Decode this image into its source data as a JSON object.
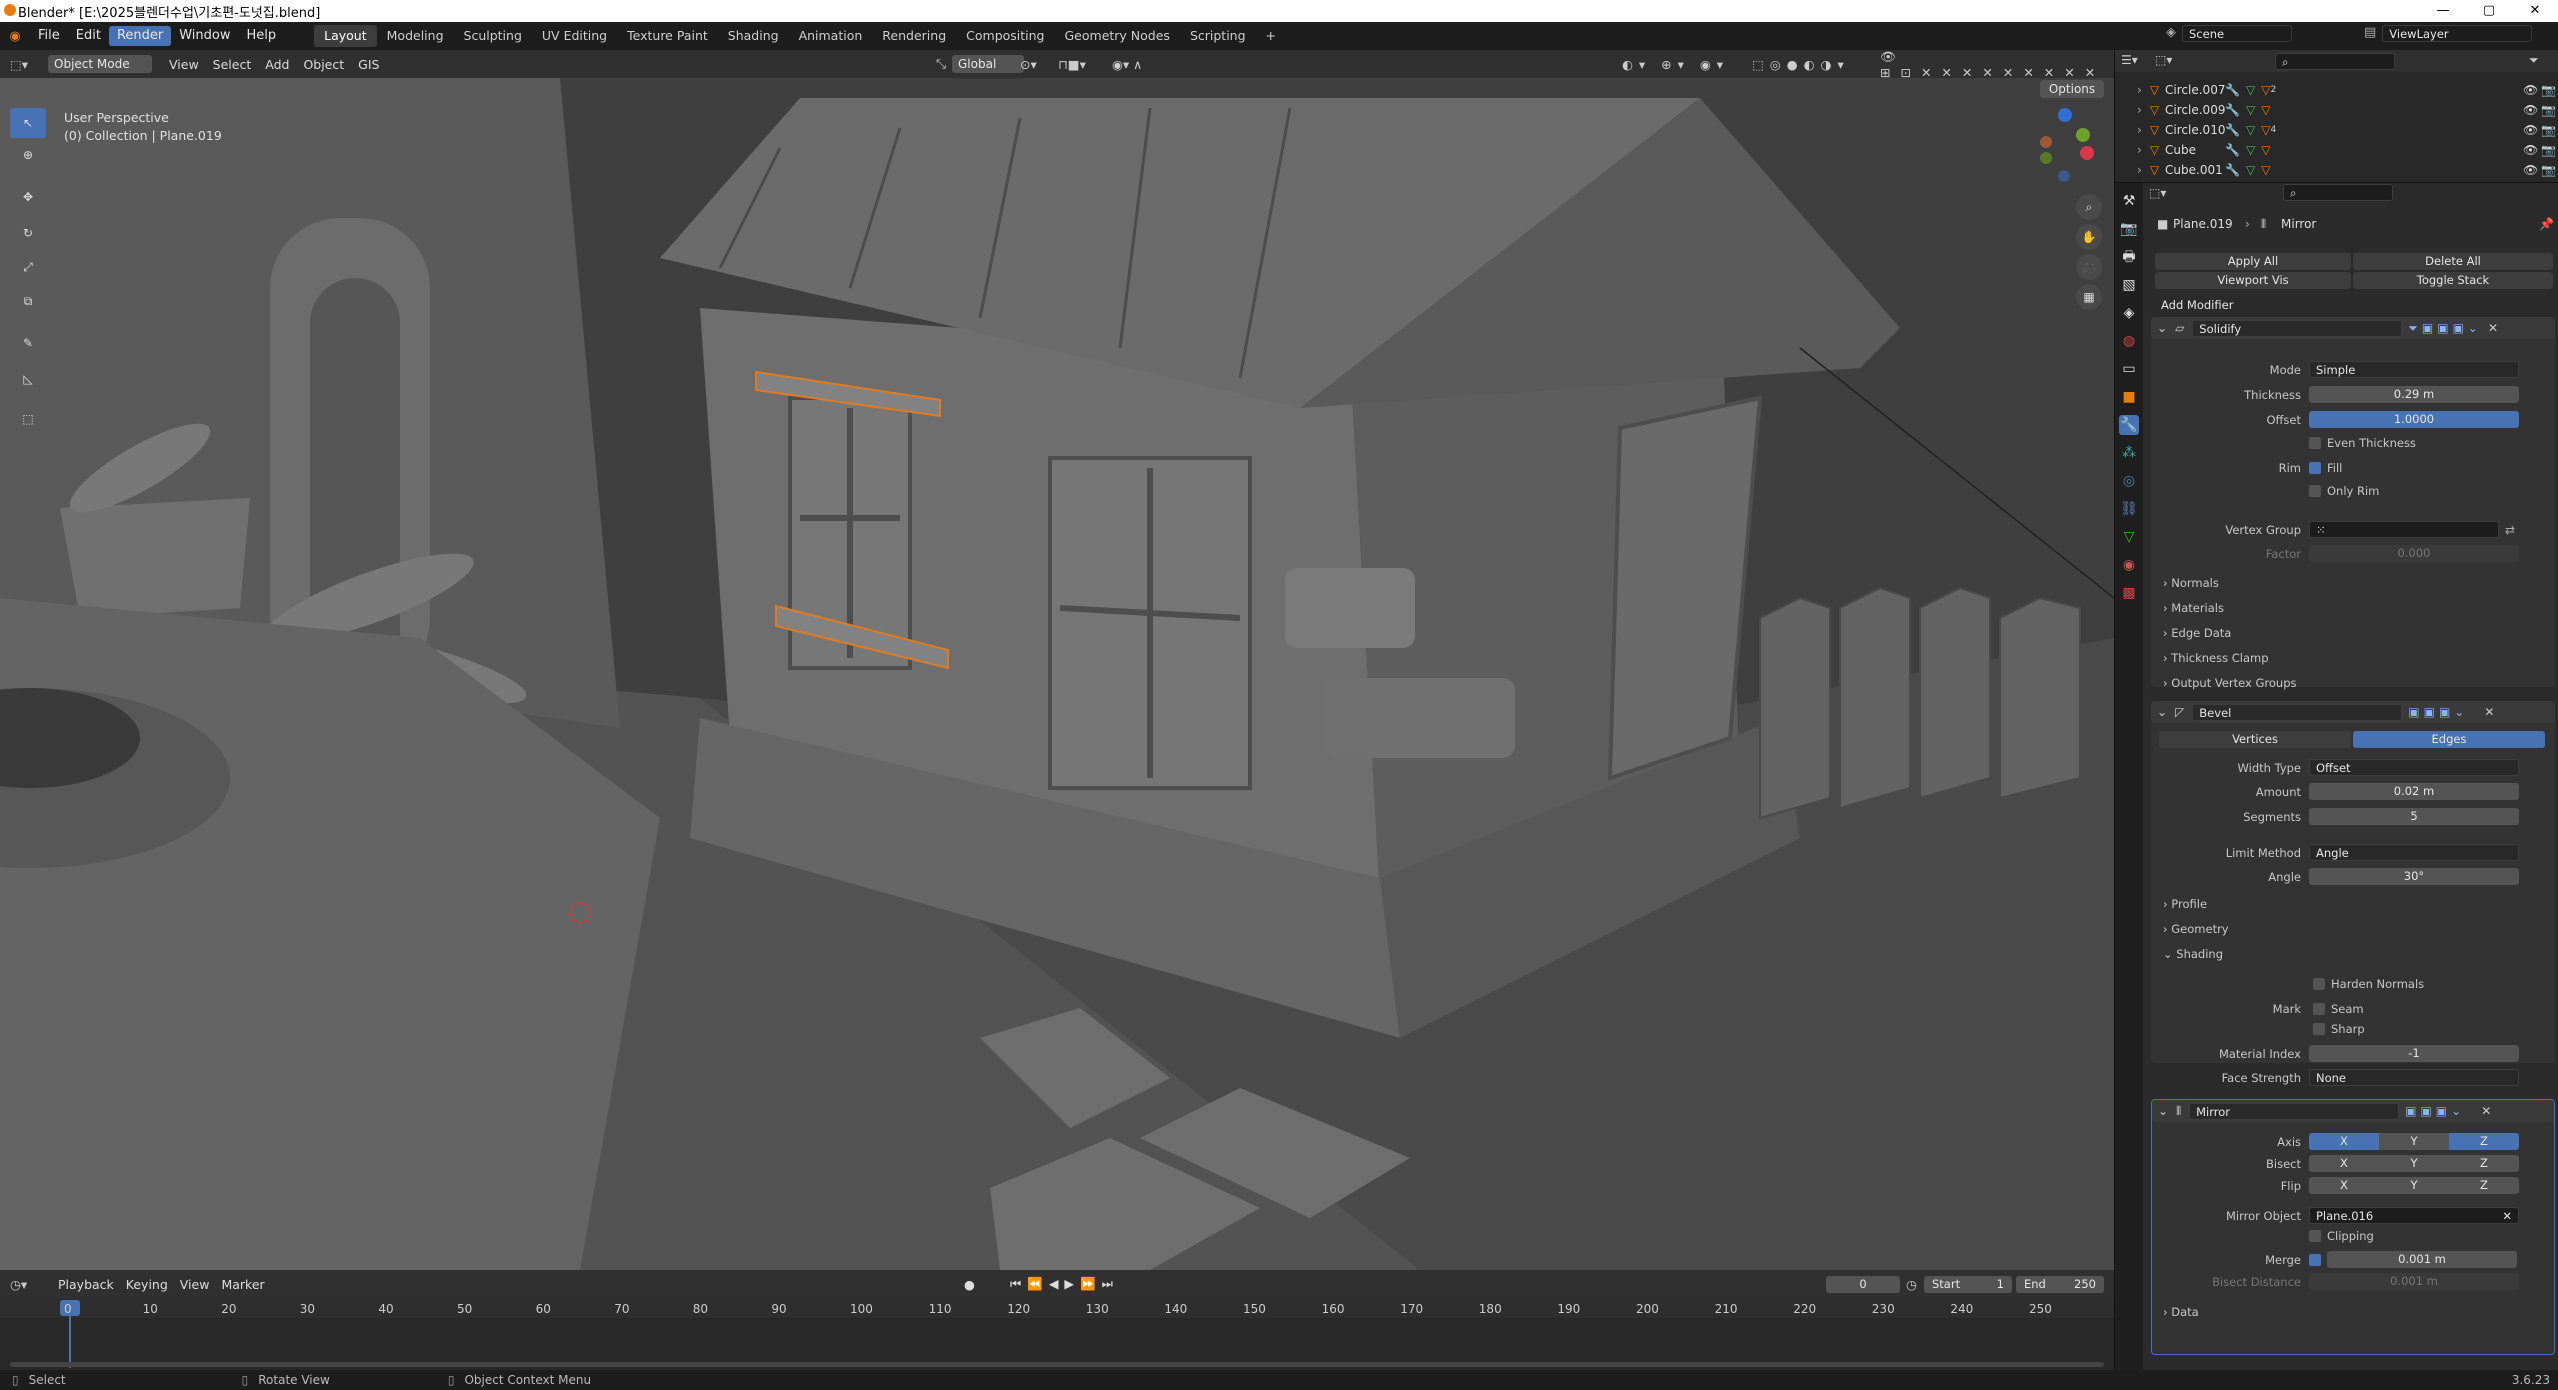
{
  "window": {
    "title": "Blender* [E:\\2025블렌더수업\\기초편-도넛집.blend]",
    "ctl_min": "—",
    "ctl_max": "▢",
    "ctl_close": "✕"
  },
  "menu": [
    "File",
    "Edit",
    "Render",
    "Window",
    "Help"
  ],
  "workspaces": [
    "Layout",
    "Modeling",
    "Sculpting",
    "UV Editing",
    "Texture Paint",
    "Shading",
    "Animation",
    "Rendering",
    "Compositing",
    "Geometry Nodes",
    "Scripting",
    "+"
  ],
  "scene": {
    "name": "Scene",
    "view_layer": "ViewLayer"
  },
  "viewport": {
    "mode": "Object Mode",
    "menus": [
      "View",
      "Select",
      "Add",
      "Object",
      "GIS"
    ],
    "orientation": "Global",
    "overlay_text_1": "User Perspective",
    "overlay_text_2": "(0) Collection | Plane.019",
    "options": "Options"
  },
  "outliner": {
    "items": [
      {
        "name": "Circle.007",
        "badge": "2"
      },
      {
        "name": "Circle.009",
        "badge": ""
      },
      {
        "name": "Circle.010",
        "badge": "4"
      },
      {
        "name": "Cube",
        "badge": ""
      },
      {
        "name": "Cube.001",
        "badge": ""
      }
    ]
  },
  "props": {
    "breadcrumb_obj": "Plane.019",
    "breadcrumb_mod": "Mirror",
    "apply_all": "Apply All",
    "delete_all": "Delete All",
    "viewport_vis": "Viewport Vis",
    "toggle_stack": "Toggle Stack",
    "add_modifier": "Add Modifier",
    "solidify": {
      "name": "Solidify",
      "mode_lbl": "Mode",
      "mode": "Simple",
      "thickness_lbl": "Thickness",
      "thickness": "0.29 m",
      "offset_lbl": "Offset",
      "offset": "1.0000",
      "even": "Even Thickness",
      "rim_lbl": "Rim",
      "fill": "Fill",
      "only_rim": "Only Rim",
      "vg_lbl": "Vertex Group",
      "factor_lbl": "Factor",
      "factor": "0.000",
      "panels": [
        "Normals",
        "Materials",
        "Edge Data",
        "Thickness Clamp",
        "Output Vertex Groups"
      ]
    },
    "bevel": {
      "name": "Bevel",
      "vertices": "Vertices",
      "edges": "Edges",
      "width_type_lbl": "Width Type",
      "width_type": "Offset",
      "amount_lbl": "Amount",
      "amount": "0.02 m",
      "segments_lbl": "Segments",
      "segments": "5",
      "limit_lbl": "Limit Method",
      "limit": "Angle",
      "angle_lbl": "Angle",
      "angle": "30°",
      "panels": [
        "Profile",
        "Geometry",
        "Shading"
      ],
      "harden": "Harden Normals",
      "mark_lbl": "Mark",
      "seam": "Seam",
      "sharp": "Sharp",
      "mat_idx_lbl": "Material Index",
      "mat_idx": "-1",
      "face_str_lbl": "Face Strength",
      "face_str": "None"
    },
    "mirror": {
      "name": "Mirror",
      "axis_lbl": "Axis",
      "bisect_lbl": "Bisect",
      "flip_lbl": "Flip",
      "x": "X",
      "y": "Y",
      "z": "Z",
      "mirror_obj_lbl": "Mirror Object",
      "mirror_obj": "Plane.016",
      "clipping": "Clipping",
      "merge_lbl": "Merge",
      "merge": "0.001 m",
      "bisect_dist_lbl": "Bisect Distance",
      "bisect_dist": "0.001 m",
      "data": "Data"
    }
  },
  "timeline": {
    "menus": [
      "Playback",
      "Keying",
      "View",
      "Marker"
    ],
    "current": "0",
    "start_lbl": "Start",
    "start": "1",
    "end_lbl": "End",
    "end": "250",
    "ticks": [
      "0",
      "10",
      "20",
      "30",
      "40",
      "50",
      "60",
      "70",
      "80",
      "90",
      "100",
      "110",
      "120",
      "130",
      "140",
      "150",
      "160",
      "170",
      "180",
      "190",
      "200",
      "210",
      "220",
      "230",
      "240",
      "250"
    ]
  },
  "status": {
    "select": "Select",
    "rotate": "Rotate View",
    "context": "Object Context Menu",
    "version": "3.6.23"
  }
}
